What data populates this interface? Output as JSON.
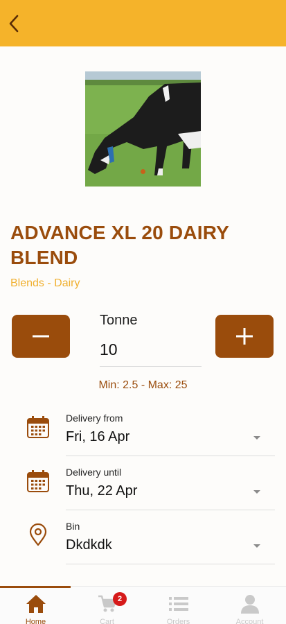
{
  "colors": {
    "accent_yellow": "#f5b32a",
    "brand_brown": "#9a4c0c",
    "category_yellow": "#f0b030",
    "badge_red": "#d61a1a",
    "muted_grey": "#c9c9c9"
  },
  "header": {
    "back_icon": "chevron-left-icon"
  },
  "product": {
    "image_icon": "cow-grazing-photo",
    "title": "ADVANCE XL 20 DAIRY BLEND",
    "category": "Blends - Dairy"
  },
  "quantity": {
    "unit": "Tonne",
    "value": "10",
    "range": "Min: 2.5 - Max: 25",
    "minus_icon": "minus-icon",
    "plus_icon": "plus-icon"
  },
  "delivery_from": {
    "label": "Delivery from",
    "value": "Fri, 16 Apr",
    "icon": "calendar-icon"
  },
  "delivery_until": {
    "label": "Delivery until",
    "value": "Thu, 22 Apr",
    "icon": "calendar-icon"
  },
  "bin": {
    "label": "Bin",
    "value": "Dkdkdk",
    "icon": "location-pin-icon"
  },
  "bottom_nav": {
    "items": [
      {
        "label": "Home",
        "icon": "home-icon",
        "active": true
      },
      {
        "label": "Cart",
        "icon": "cart-icon",
        "badge": "2"
      },
      {
        "label": "Orders",
        "icon": "list-icon"
      },
      {
        "label": "Account",
        "icon": "user-icon"
      }
    ]
  }
}
